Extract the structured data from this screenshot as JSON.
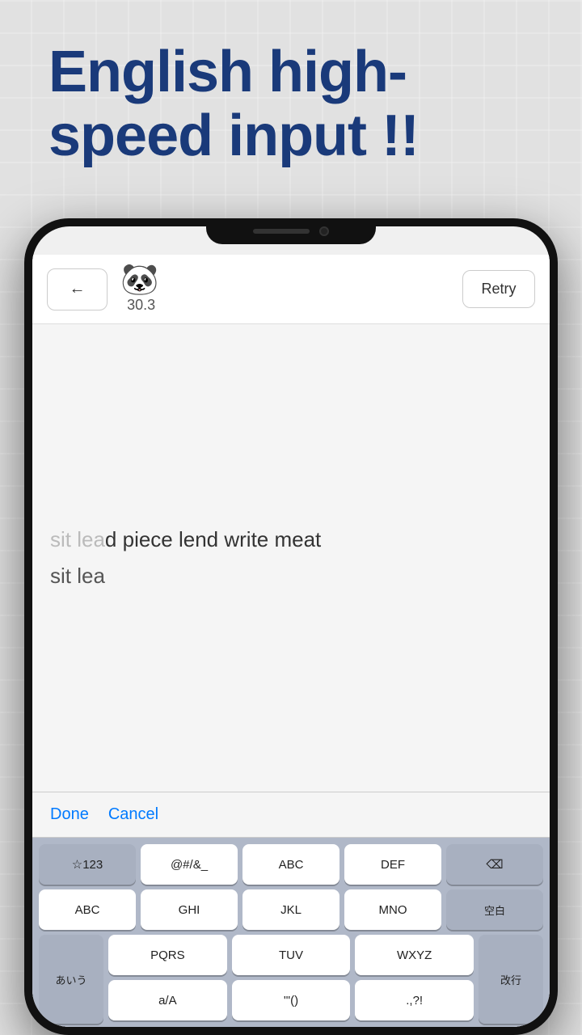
{
  "hero": {
    "title": "English high-speed input !!"
  },
  "topbar": {
    "back_label": "←",
    "score": "30.3",
    "retry_label": "Retry"
  },
  "text_area": {
    "target_text_typed": "sit lea",
    "target_text_remaining": "d piece lend write meat",
    "input_text": "sit lea"
  },
  "action_bar": {
    "done_label": "Done",
    "cancel_label": "Cancel"
  },
  "keyboard": {
    "row1": [
      "☆123",
      "@#/&_",
      "ABC",
      "DEF",
      "⌫"
    ],
    "row2": [
      "ABC",
      "GHI",
      "JKL",
      "MNO",
      "空白"
    ],
    "row3_left": "あいう",
    "row3_middle1": [
      "PQRS",
      "TUV",
      "WXYZ"
    ],
    "row3_middle2": [
      "a/A",
      "'\"()",
      ".,?!"
    ],
    "row3_right": "改行"
  }
}
